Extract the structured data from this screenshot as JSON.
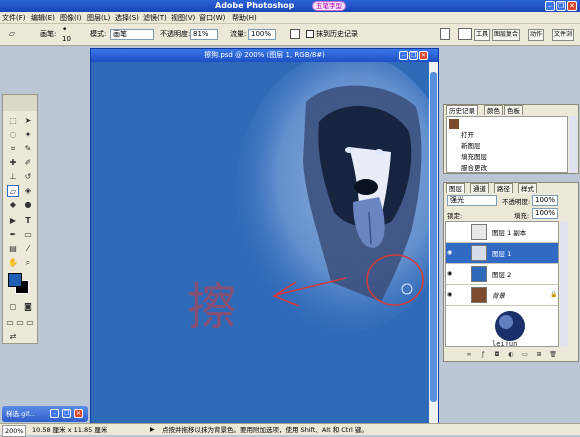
{
  "app": {
    "title": "Adobe Photoshop",
    "badge": "五笔字型"
  },
  "menu": [
    "文件(F)",
    "编辑(E)",
    "图像(I)",
    "图层(L)",
    "选择(S)",
    "滤镜(T)",
    "视图(V)",
    "窗口(W)",
    "帮助(H)"
  ],
  "options": {
    "brush_label": "画笔:",
    "brush_size": "10",
    "mode_label": "模式:",
    "mode_value": "画笔",
    "opacity_label": "不透明度:",
    "opacity_value": "81%",
    "flow_label": "流量:",
    "flow_value": "100%",
    "history_erase": "抹到历史记录"
  },
  "dock_tabs": [
    "工具",
    "图层复合",
    "动作",
    "文件浏"
  ],
  "document": {
    "title": "擦狗.psd @ 200% (图层 1, RGB/8#)",
    "annotation": "擦"
  },
  "history": {
    "tabs": [
      "历史记录",
      "颜色",
      "色板"
    ],
    "items": [
      "打开",
      "新图层",
      "填充图层",
      "服合更改"
    ]
  },
  "layers": {
    "tabs": [
      "图层",
      "通道",
      "路径",
      "样式"
    ],
    "blend": "强光",
    "opacity_label": "不透明度:",
    "opacity_value": "100%",
    "lock_label": "锁定:",
    "fill_label": "填充:",
    "fill_value": "100%",
    "items": [
      {
        "name": "图层 1 副本",
        "selected": false
      },
      {
        "name": "图层 1",
        "selected": true
      },
      {
        "name": "图层 2",
        "selected": false
      },
      {
        "name": "背景",
        "selected": false
      }
    ],
    "watermark": "leijun"
  },
  "statusbar": {
    "zoom": "200%",
    "size": "10.58 厘米 x 11.85 厘米",
    "hint": "点按并拖移以抹为背景色。要用附加选项，使用 Shift、Alt 和 Ctrl 键。"
  },
  "taskbar": {
    "item": "梯选.gif..."
  },
  "colors": {
    "titlebar": "#1a4fc4",
    "canvas": "#2f6ab9",
    "foreground": "#1e5fb0",
    "background": "#000000",
    "annotation": "#d23b3b"
  }
}
